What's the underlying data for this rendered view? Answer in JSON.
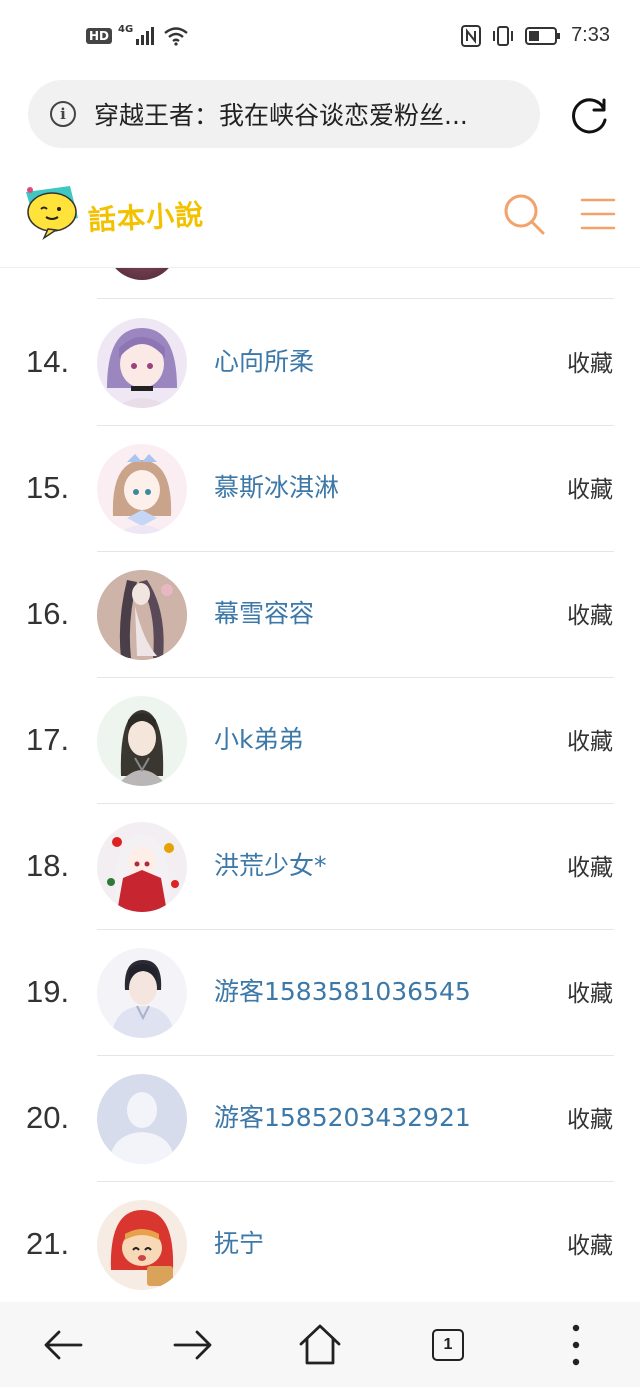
{
  "status_bar": {
    "hd_label": "HD",
    "network_label": "4G",
    "time": "7:33"
  },
  "browser": {
    "page_title": "穿越王者：我在峡谷谈恋爱粉丝...",
    "info_icon": "i",
    "tab_count": "1"
  },
  "site": {
    "logo_text": "話本小說",
    "brand_color": "#f2a26b"
  },
  "list": {
    "action_label": "收藏",
    "rows": [
      {
        "rank": "14.",
        "name": "心向所柔"
      },
      {
        "rank": "15.",
        "name": "慕斯冰淇淋"
      },
      {
        "rank": "16.",
        "name": "幕雪容容"
      },
      {
        "rank": "17.",
        "name": "小k弟弟"
      },
      {
        "rank": "18.",
        "name": "洪荒少女*"
      },
      {
        "rank": "19.",
        "name": "游客1583581036545"
      },
      {
        "rank": "20.",
        "name": "游客1585203432921"
      },
      {
        "rank": "21.",
        "name": "抚宁"
      }
    ]
  }
}
